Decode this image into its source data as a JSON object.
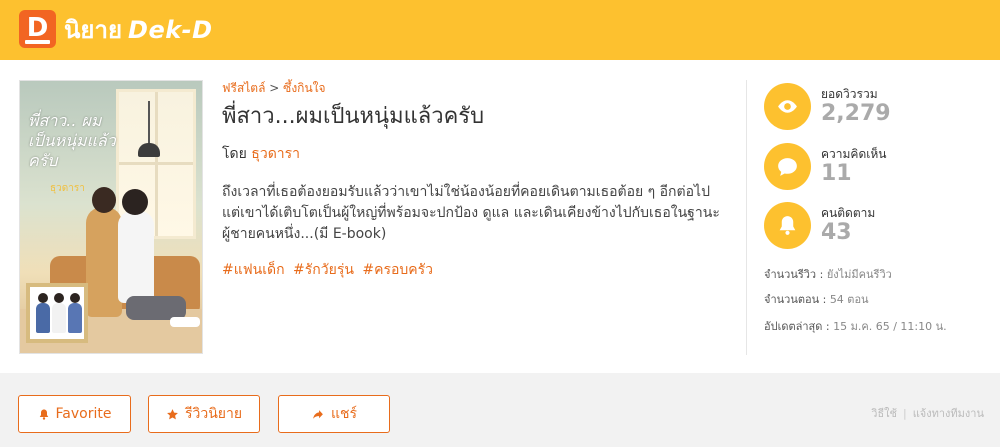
{
  "header": {
    "logo_letter": "D",
    "logo_thai": "นิยาย",
    "logo_brand": "Dek-D",
    "colors": {
      "bar": "#fdc12f",
      "logo": "#f26522"
    }
  },
  "cover": {
    "title": "พี่สาว.. ผมเป็นหนุ่มแล้วครับ",
    "author": "ธุวดารา"
  },
  "novel": {
    "breadcrumb_1": "ฟรีสไตล์",
    "breadcrumb_sep": ">",
    "breadcrumb_2": "ซึ้งกินใจ",
    "title": "พี่สาว...ผมเป็นหนุ่มแล้วครับ",
    "by_label": "โดย",
    "author": "ธุวดารา",
    "description": "ถึงเวลาที่เธอต้องยอมรับแล้วว่าเขาไม่ใช่น้องน้อยที่คอยเดินตามเธอต้อย ๆ อีกต่อไป แต่เขาได้เติบโตเป็นผู้ใหญ่ที่พร้อมจะปกป้อง ดูแล และเดินเคียงข้างไปกับเธอในฐานะผู้ชายคนหนึ่ง...(มี E-book)",
    "tags": [
      "#แฟนเด็ก",
      "#รักวัยรุ่น",
      "#ครอบครัว"
    ],
    "accent_color": "#e86c1c"
  },
  "stats": {
    "views_label": "ยอดวิวรวม",
    "views_value": "2,279",
    "comments_label": "ความคิดเห็น",
    "comments_value": "11",
    "followers_label": "คนติดตาม",
    "followers_value": "43",
    "icons": [
      "eye-icon",
      "speech-bubble-icon",
      "bell-icon"
    ]
  },
  "info": {
    "reviews_label": "จำนวนรีวิว :",
    "reviews_value": "ยังไม่มีคนรีวิว",
    "chapters_label": "จำนวนตอน :",
    "chapters_value": "54 ตอน",
    "updated_label": "อัปเดตล่าสุด :",
    "updated_value": "15 ม.ค. 65 / 11:10 น."
  },
  "actions": {
    "favorite": "Favorite",
    "review": "รีวิวนิยาย",
    "share": "แชร์"
  },
  "footer": {
    "link_1": "วิธีใช้",
    "separator": "|",
    "link_2": "แจ้งทางทีมงาน"
  }
}
